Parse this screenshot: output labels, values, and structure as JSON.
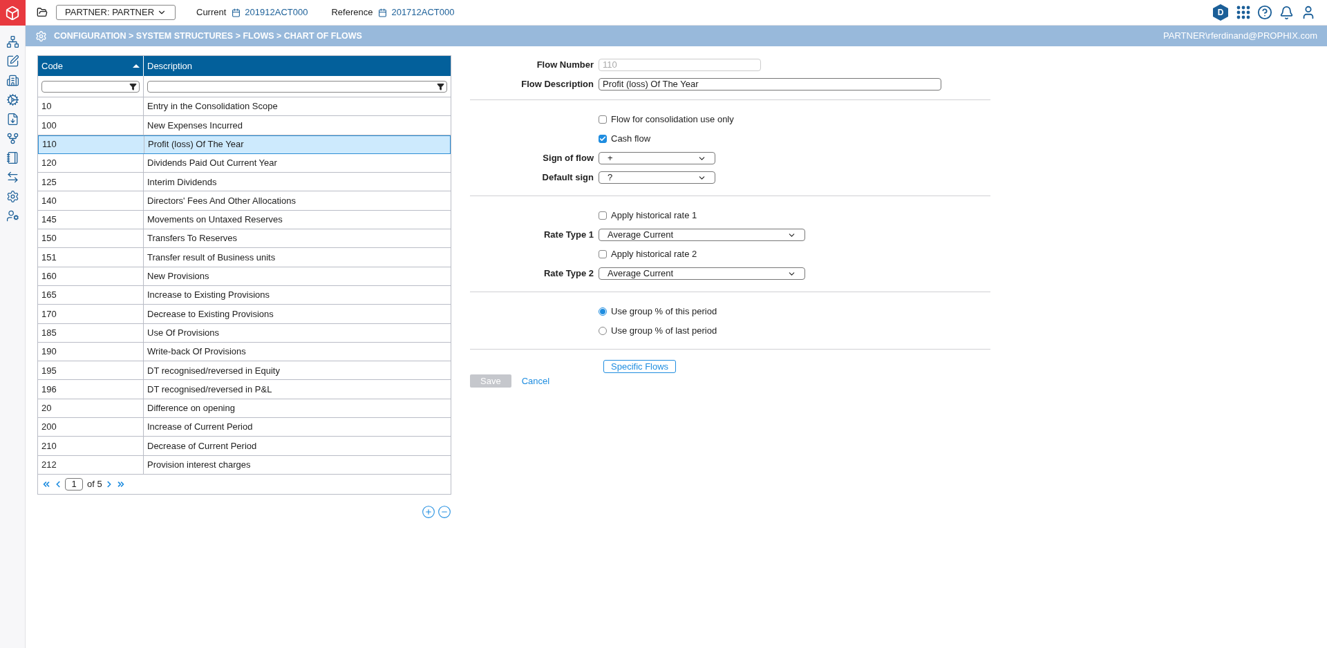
{
  "top_bar": {
    "entity": "PARTNER: PARTNER",
    "current_label": "Current",
    "current_value": "201912ACT000",
    "reference_label": "Reference",
    "reference_value": "201712ACT000",
    "badge": "D"
  },
  "breadcrumb": {
    "path": "CONFIGURATION > SYSTEM STRUCTURES > FLOWS > CHART OF FLOWS",
    "user": "PARTNER\\rferdinand@PROPHIX.com"
  },
  "table": {
    "columns": [
      {
        "label": "Code",
        "sorted": true
      },
      {
        "label": "Description",
        "sorted": false
      }
    ],
    "rows": [
      {
        "code": "10",
        "description": "Entry in the Consolidation Scope",
        "selected": false
      },
      {
        "code": "100",
        "description": "New Expenses Incurred",
        "selected": false
      },
      {
        "code": "110",
        "description": "Profit (loss) Of The Year",
        "selected": true
      },
      {
        "code": "120",
        "description": "Dividends Paid Out Current Year",
        "selected": false
      },
      {
        "code": "125",
        "description": "Interim Dividends",
        "selected": false
      },
      {
        "code": "140",
        "description": "Directors' Fees And Other Allocations",
        "selected": false
      },
      {
        "code": "145",
        "description": "Movements on Untaxed Reserves",
        "selected": false
      },
      {
        "code": "150",
        "description": "Transfers To Reserves",
        "selected": false
      },
      {
        "code": "151",
        "description": "Transfer result of Business units",
        "selected": false
      },
      {
        "code": "160",
        "description": "New Provisions",
        "selected": false
      },
      {
        "code": "165",
        "description": "Increase to Existing Provisions",
        "selected": false
      },
      {
        "code": "170",
        "description": "Decrease to Existing Provisions",
        "selected": false
      },
      {
        "code": "185",
        "description": "Use Of Provisions",
        "selected": false
      },
      {
        "code": "190",
        "description": "Write-back Of Provisions",
        "selected": false
      },
      {
        "code": "195",
        "description": "DT recognised/reversed in Equity",
        "selected": false
      },
      {
        "code": "196",
        "description": "DT recognised/reversed in P&L",
        "selected": false
      },
      {
        "code": "20",
        "description": "Difference on opening",
        "selected": false
      },
      {
        "code": "200",
        "description": "Increase of Current Period",
        "selected": false
      },
      {
        "code": "210",
        "description": "Decrease of Current Period",
        "selected": false
      },
      {
        "code": "212",
        "description": "Provision interest charges",
        "selected": false
      }
    ],
    "pagination": {
      "page": "1",
      "total": "of 5"
    }
  },
  "form": {
    "flow_number": {
      "label": "Flow Number",
      "value": "110",
      "disabled": true
    },
    "flow_description": {
      "label": "Flow Description",
      "value": "Profit (loss) Of The Year"
    },
    "sections": [
      [
        {
          "kind": "checkbox",
          "label": "Flow for consolidation use only",
          "checked": false
        },
        {
          "kind": "checkbox",
          "label": "Cash flow",
          "checked": true
        },
        {
          "kind": "select",
          "label": "Sign of flow",
          "value": "+",
          "wide": false
        },
        {
          "kind": "select",
          "label": "Default sign",
          "value": "?",
          "wide": false
        }
      ],
      [
        {
          "kind": "checkbox",
          "label": "Apply historical rate 1",
          "checked": false
        },
        {
          "kind": "select",
          "label": "Rate Type 1",
          "value": "Average Current",
          "wide": true
        },
        {
          "kind": "checkbox",
          "label": "Apply historical rate 2",
          "checked": false
        },
        {
          "kind": "select",
          "label": "Rate Type 2",
          "value": "Average Current",
          "wide": true
        }
      ],
      [
        {
          "kind": "radio",
          "label": "Use group % of this period",
          "selected": true
        },
        {
          "kind": "radio",
          "label": "Use group % of last period",
          "selected": false
        }
      ]
    ],
    "specific_button": "Specific Flows",
    "save": {
      "label": "Save",
      "disabled": true
    },
    "cancel": "Cancel"
  }
}
